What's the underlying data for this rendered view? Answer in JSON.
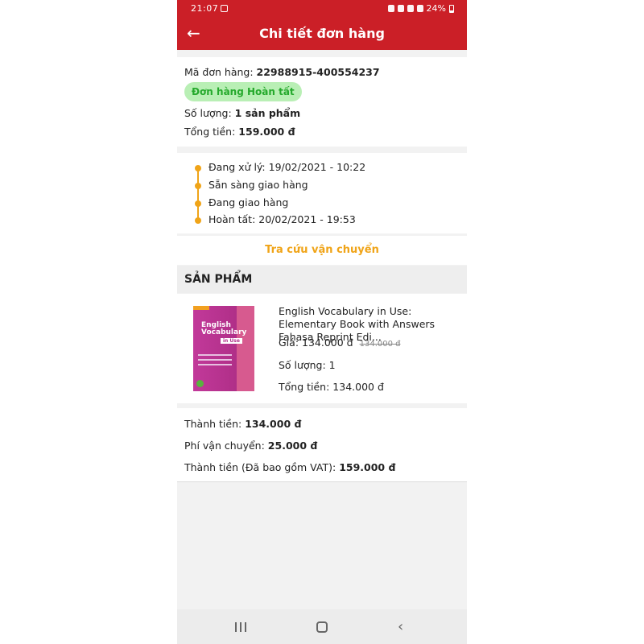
{
  "status_bar": {
    "time": "21:07",
    "battery": "24%"
  },
  "header": {
    "title": "Chi tiết đơn hàng",
    "back_icon": "arrow-left-icon"
  },
  "order": {
    "code_label": "Mã đơn hàng:",
    "code": "22988915-400554237",
    "status": "Đơn hàng Hoàn tất",
    "qty_label": "Số lượng:",
    "qty": "1 sản phẩm",
    "total_label": "Tổng tiền:",
    "total": "159.000 đ"
  },
  "timeline": [
    "Đang xử lý: 19/02/2021 - 10:22",
    "Sẵn sàng giao hàng",
    "Đang giao hàng",
    "Hoàn tất: 20/02/2021 - 19:53"
  ],
  "track_link": "Tra cứu vận chuyển",
  "products_section": {
    "title": "SẢN PHẨM"
  },
  "product": {
    "name": "English Vocabulary in Use: Elementary Book with Answers Fahasa Reprint Edi...",
    "cover_title": "English Vocabulary",
    "cover_tag": "in Use",
    "price_label": "Giá:",
    "price": "134.000 đ",
    "old_price": "134.000 đ",
    "qty_label": "Số lượng:",
    "qty": "1",
    "subtotal_label": "Tổng tiền:",
    "subtotal": "134.000 đ"
  },
  "summary": {
    "subtotal_label": "Thành tiền:",
    "subtotal": "134.000 đ",
    "shipping_label": "Phí vận chuyển:",
    "shipping": "25.000 đ",
    "grand_label": "Thành tiền (Đã bao gồm VAT):",
    "grand": "159.000 đ"
  },
  "colors": {
    "brand_red": "#cb1f27",
    "accent_orange": "#f0a418",
    "success_green": "#25a92c"
  }
}
